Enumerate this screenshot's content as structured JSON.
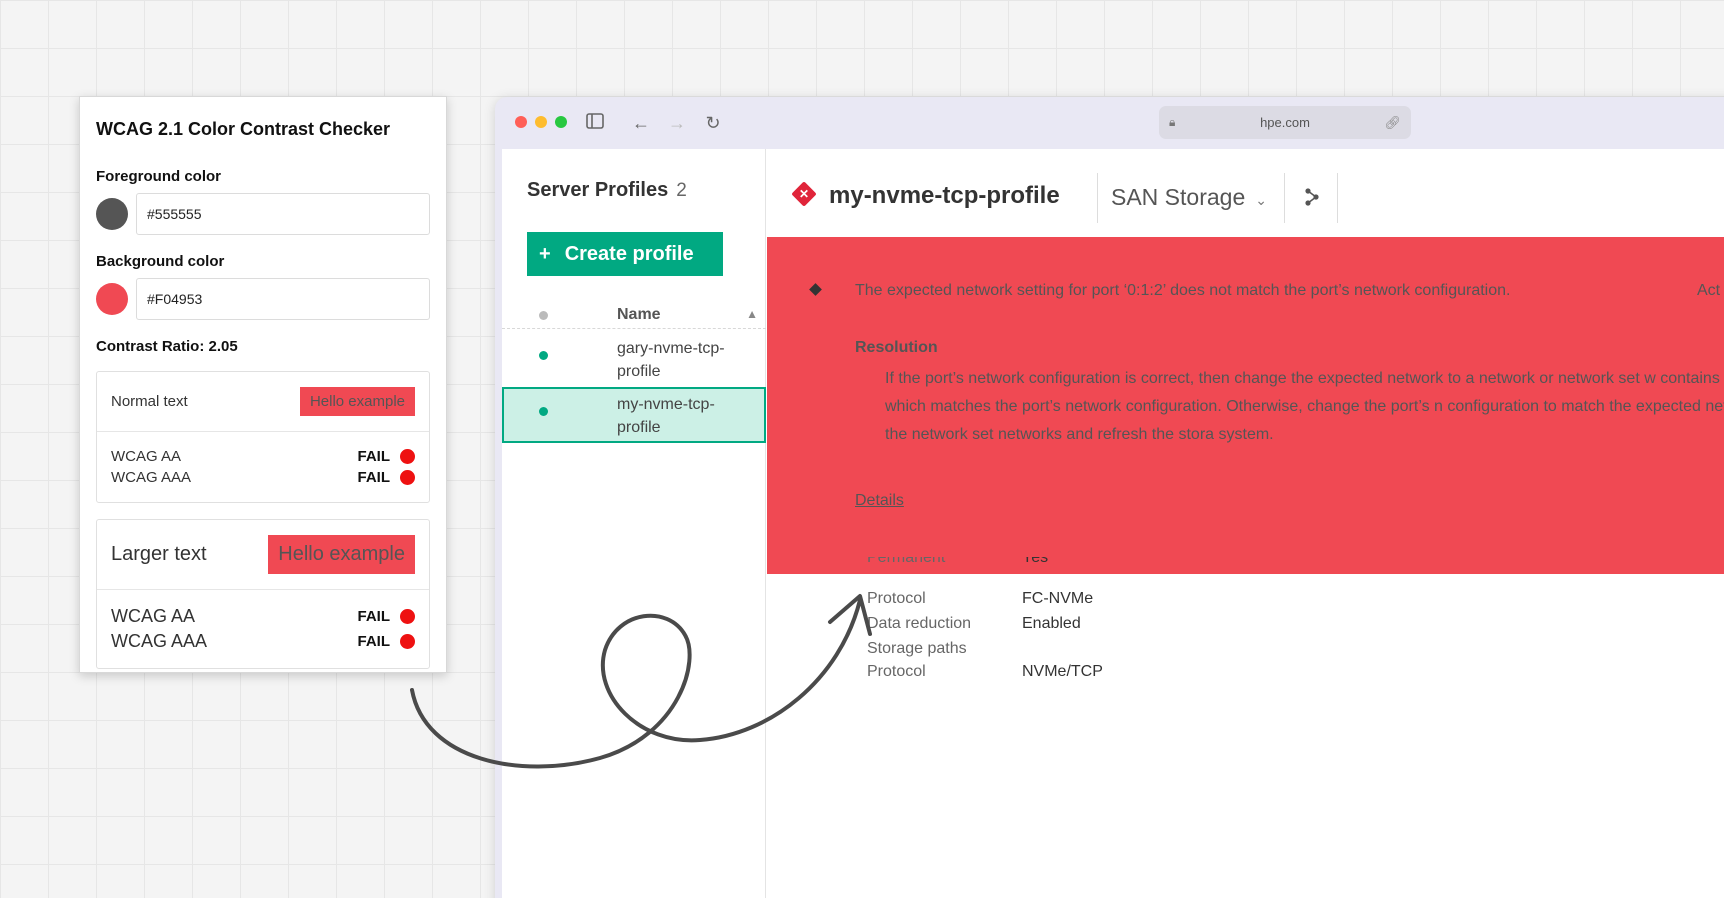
{
  "checker": {
    "title": "WCAG 2.1 Color Contrast Checker",
    "foreground_label": "Foreground color",
    "foreground_value": "#555555",
    "background_label": "Background color",
    "background_value": "#F04953",
    "contrast_ratio": "Contrast Ratio: 2.05",
    "normal": {
      "label": "Normal text",
      "example": "Hello example",
      "results": [
        {
          "level": "WCAG AA",
          "result": "FAIL"
        },
        {
          "level": "WCAG AAA",
          "result": "FAIL"
        }
      ]
    },
    "large": {
      "label": "Larger text",
      "example": "Hello example",
      "results": [
        {
          "level": "WCAG AA",
          "result": "FAIL"
        },
        {
          "level": "WCAG AAA",
          "result": "FAIL"
        }
      ]
    }
  },
  "browser": {
    "url": "hpe.com",
    "colors": {
      "close": "#ff5f57",
      "minimize": "#febc2e",
      "zoom": "#28c840"
    }
  },
  "sidebar": {
    "title": "Server Profiles",
    "count": "2",
    "create_label": "Create profile",
    "column_name": "Name",
    "rows": [
      {
        "label": "gary-nvme-tcp-profile"
      },
      {
        "label": "my-nvme-tcp-profile"
      }
    ]
  },
  "main": {
    "title": "my-nvme-tcp-profile",
    "dropdown": "SAN Storage",
    "alert": {
      "message": "The expected network setting for port ‘0:1:2’ does not match the port’s network configuration.",
      "action_clipped": "Act",
      "resolution_title": "Resolution",
      "resolution_body": "If the port’s network configuration is correct, then change the expected network to a network or network set w contains at least one network which matches the port’s network configuration.  Otherwise, change the port’s n configuration to match the expected network or at least one of the network set networks and refresh the stora system.",
      "details_link": "Details"
    },
    "properties": [
      {
        "key": "Permanent",
        "value": "Yes"
      },
      {
        "key": "Protocol",
        "value": "FC-NVMe"
      },
      {
        "key": "Data reduction",
        "value": "Enabled"
      },
      {
        "key": "Storage paths",
        "value": ""
      },
      {
        "key": "Protocol",
        "value": "NVMe/TCP"
      }
    ]
  }
}
